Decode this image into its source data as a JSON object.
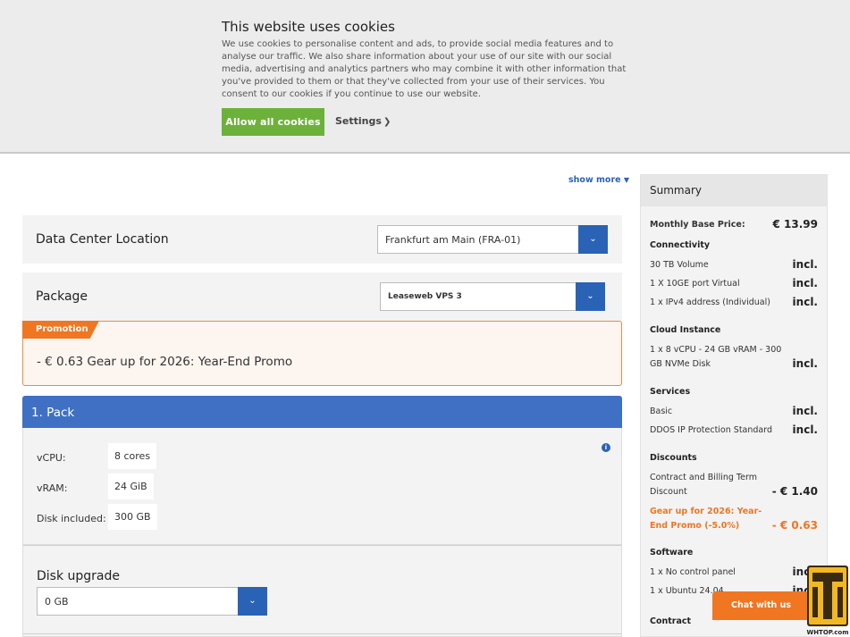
{
  "cookie": {
    "title": "This website uses cookies",
    "text": "We use cookies to personalise content and ads, to provide social media features and to analyse our traffic. We also share information about your use of our site with our social media, advertising and analytics partners who may combine it with other information that you've provided to them or that they've collected from your use of their services. You consent to our cookies if you continue to use our website.",
    "allow_label": "Allow all cookies",
    "settings_label": "Settings"
  },
  "show_more": "show more",
  "location": {
    "title": "Data Center Location",
    "selected": "Frankfurt am Main (FRA-01)"
  },
  "package": {
    "title": "Package",
    "selected": "Leaseweb VPS 3"
  },
  "promotion": {
    "tag": "Promotion",
    "text": "- € 0.63 Gear up for 2026: Year-End Promo"
  },
  "pack": {
    "title": "1. Pack",
    "specs": [
      {
        "label": "vCPU:",
        "value": "8 cores"
      },
      {
        "label": "vRAM:",
        "value": "24 GiB"
      },
      {
        "label": "Disk included:",
        "value": "300 GB"
      }
    ]
  },
  "disk_upgrade": {
    "title": "Disk upgrade",
    "selected": "0 GB"
  },
  "summary": {
    "title": "Summary",
    "base_label": "Monthly Base Price:",
    "base_value": "€ 13.99",
    "connectivity": {
      "title": "Connectivity",
      "items": [
        {
          "label": "30 TB Volume",
          "value": "incl."
        },
        {
          "label": "1 X 10GE port Virtual",
          "value": "incl."
        },
        {
          "label": "1 x IPv4 address (Individual)",
          "value": "incl."
        }
      ]
    },
    "cloud_instance": {
      "title": "Cloud Instance",
      "label": "1 x 8 vCPU - 24 GB vRAM - 300 GB NVMe Disk",
      "value": "incl."
    },
    "services": {
      "title": "Services",
      "items": [
        {
          "label": "Basic",
          "value": "incl."
        },
        {
          "label": "DDOS IP Protection Standard",
          "value": "incl."
        }
      ]
    },
    "discounts": {
      "title": "Discounts",
      "items": [
        {
          "label": "Contract and Billing Term Discount",
          "value": "- € 1.40"
        },
        {
          "label": "Gear up for 2026: Year-End Promo (-5.0%)",
          "value": "- € 0.63"
        }
      ]
    },
    "software": {
      "title": "Software",
      "items": [
        {
          "label": "1 x No control panel",
          "value": "incl."
        },
        {
          "label": "1 x Ubuntu 24.04",
          "value": "incl."
        }
      ]
    },
    "contract_title": "Contract"
  },
  "chat_label": "Chat with us",
  "logo_text": "WHTOP.com",
  "colors": {
    "accent_blue": "#2a63b5",
    "header_blue": "#3f70c4",
    "orange": "#f07622",
    "green": "#6cb23a"
  }
}
